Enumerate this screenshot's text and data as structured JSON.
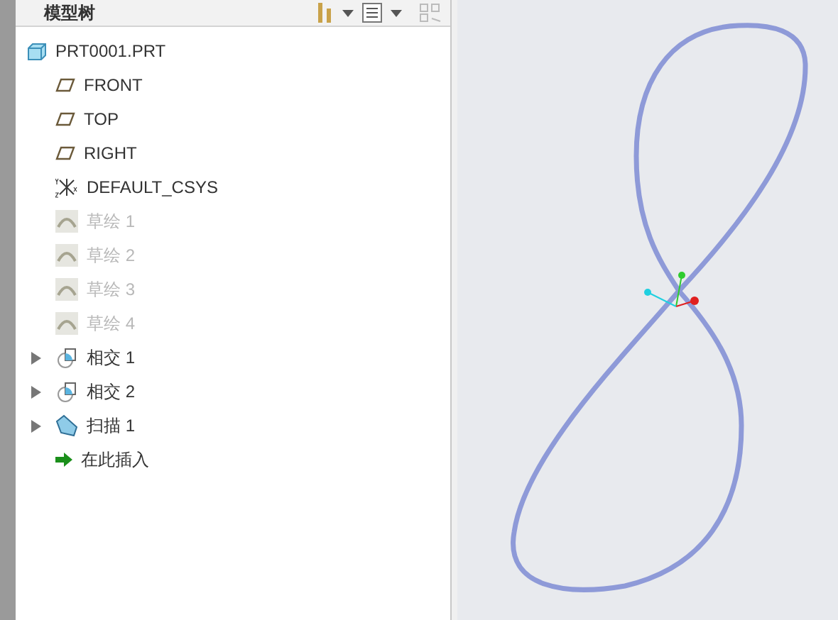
{
  "model_tree": {
    "title": "模型树",
    "items": [
      {
        "kind": "part",
        "label": "PRT0001.PRT",
        "disabled": false,
        "expandable": false
      },
      {
        "kind": "plane",
        "label": "FRONT",
        "disabled": false,
        "expandable": false
      },
      {
        "kind": "plane",
        "label": "TOP",
        "disabled": false,
        "expandable": false
      },
      {
        "kind": "plane",
        "label": "RIGHT",
        "disabled": false,
        "expandable": false
      },
      {
        "kind": "csys",
        "label": "DEFAULT_CSYS",
        "disabled": false,
        "expandable": false
      },
      {
        "kind": "sketch",
        "label": "草绘 1",
        "disabled": true,
        "expandable": false
      },
      {
        "kind": "sketch",
        "label": "草绘 2",
        "disabled": true,
        "expandable": false
      },
      {
        "kind": "sketch",
        "label": "草绘 3",
        "disabled": true,
        "expandable": false
      },
      {
        "kind": "sketch",
        "label": "草绘 4",
        "disabled": true,
        "expandable": false
      },
      {
        "kind": "intersect",
        "label": "相交 1",
        "disabled": false,
        "expandable": true
      },
      {
        "kind": "intersect",
        "label": "相交 2",
        "disabled": false,
        "expandable": true
      },
      {
        "kind": "sweep",
        "label": "扫描 1",
        "disabled": false,
        "expandable": true
      },
      {
        "kind": "insert",
        "label": "在此插入",
        "disabled": false,
        "expandable": false
      }
    ]
  }
}
